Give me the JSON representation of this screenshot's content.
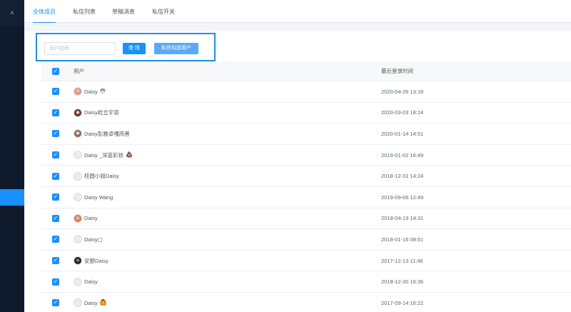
{
  "sidebar": {
    "collapse_glyph": "˄"
  },
  "tabs": [
    {
      "label": "全体成员",
      "active": true
    },
    {
      "label": "私信列表",
      "active": false
    },
    {
      "label": "草稿消息",
      "active": false
    },
    {
      "label": "私信开关",
      "active": false
    }
  ],
  "toolbar": {
    "search_placeholder": "用户昵称",
    "search_value": "",
    "search_button": "查 找",
    "message_button": "私信勾选用户"
  },
  "table": {
    "columns": {
      "user": "用户",
      "last_login": "最近登录时间"
    },
    "rows": [
      {
        "name": "Daisy",
        "emoji": "😳",
        "avatar": "a1",
        "time": "2020-04-26 13:16"
      },
      {
        "name": "Daisy屹立宇宙",
        "emoji": "",
        "avatar": "a2",
        "time": "2020-03-03 18:24"
      },
      {
        "name": "Daisy彭雅卓嘎而善",
        "emoji": "",
        "avatar": "a3",
        "time": "2020-01-14 14:51"
      },
      {
        "name": "Daisy _深蓝彩妆",
        "emoji": "💩",
        "avatar": "",
        "time": "2019-01-02 16:49"
      },
      {
        "name": "桂圆小姐Daisy",
        "emoji": "",
        "avatar": "",
        "time": "2018-12-31 14:24"
      },
      {
        "name": "Daisy Wang",
        "emoji": "",
        "avatar": "",
        "time": "2019-09-06 12:49"
      },
      {
        "name": "Daisy",
        "emoji": "",
        "avatar": "a4",
        "time": "2018-04-19 14:31"
      },
      {
        "name": "Daisy▢",
        "emoji": "",
        "avatar": "",
        "time": "2018-01-16 08:51"
      },
      {
        "name": "安那Daisy",
        "emoji": "",
        "avatar": "a5",
        "time": "2017-12-13 11:46"
      },
      {
        "name": "Daisy",
        "emoji": "",
        "avatar": "",
        "time": "2018-12-30 16:36"
      },
      {
        "name": "Daisy",
        "emoji": "🙆",
        "avatar": "",
        "time": "2017-09-14 16:22"
      }
    ]
  }
}
